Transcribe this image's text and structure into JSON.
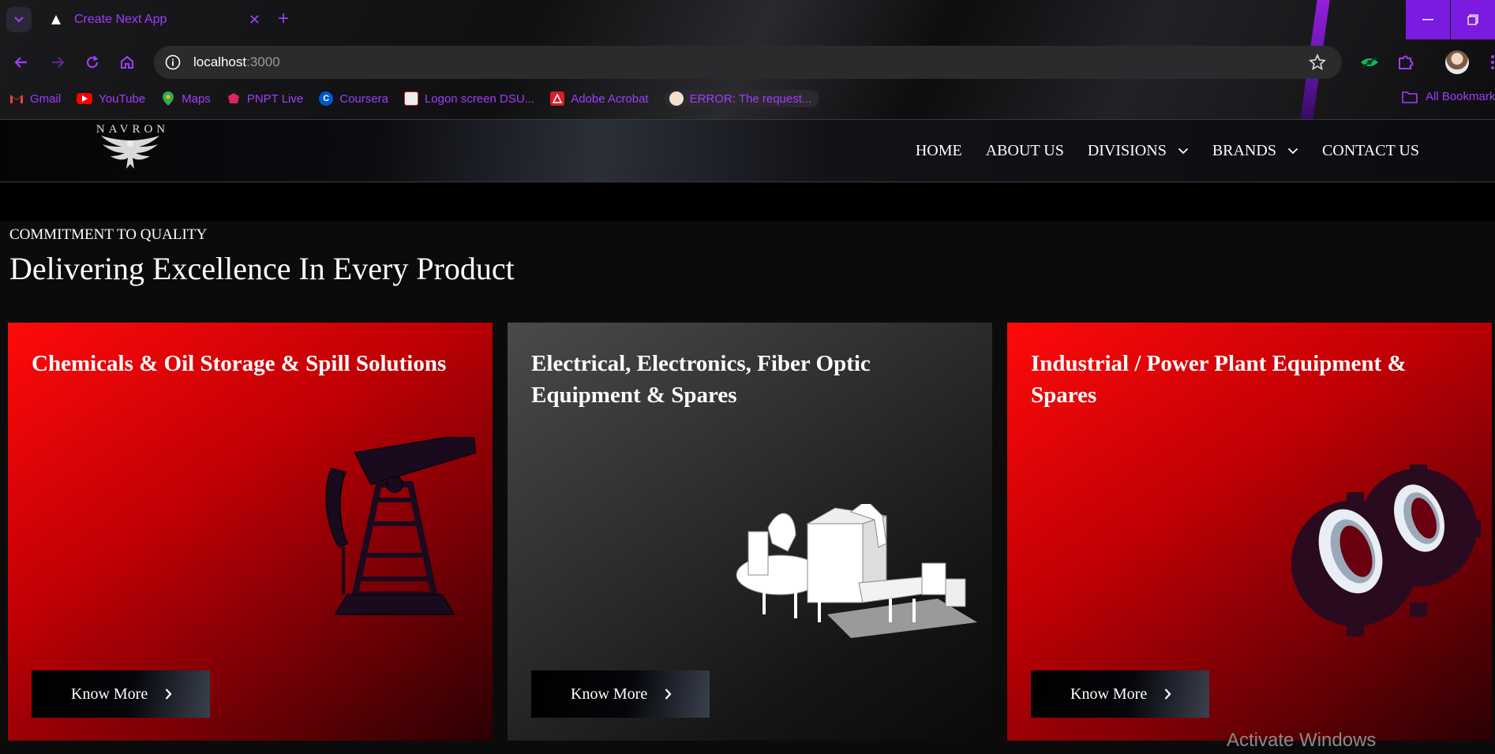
{
  "browser": {
    "tab_title": "Create Next App",
    "url_host": "localhost",
    "url_port": ":3000",
    "accent": "#a13cff",
    "bookmarks": [
      {
        "label": "Gmail",
        "icon": "gmail-icon"
      },
      {
        "label": "YouTube",
        "icon": "youtube-icon"
      },
      {
        "label": "Maps",
        "icon": "maps-icon"
      },
      {
        "label": "PNPT Live",
        "icon": "pnpt-icon"
      },
      {
        "label": "Coursera",
        "icon": "coursera-icon"
      },
      {
        "label": "Logon screen DSU...",
        "icon": "dsu-icon"
      },
      {
        "label": "Adobe Acrobat",
        "icon": "acrobat-icon"
      },
      {
        "label": "ERROR: The request...",
        "icon": "error-page-icon"
      }
    ],
    "all_bookmarks": "All Bookmark"
  },
  "site": {
    "logo_text": "NAVRON",
    "nav": [
      {
        "label": "HOME"
      },
      {
        "label": "ABOUT US"
      },
      {
        "label": "DIVISIONS"
      },
      {
        "label": "BRANDS"
      },
      {
        "label": "CONTACT US"
      }
    ]
  },
  "main": {
    "eyebrow": "COMMITMENT TO QUALITY",
    "headline": "Delivering Excellence In Every Product",
    "cards": [
      {
        "title": "Chemicals & Oil Storage & Spill Solutions",
        "button": "Know More",
        "image": "oil-pump-icon",
        "color": "#ff0a0a"
      },
      {
        "title": "Electrical, Electronics, Fiber Optic Equipment & Spares",
        "button": "Know More",
        "image": "industrial-machine-icon",
        "color": "#4a4a4a"
      },
      {
        "title": "Industrial / Power Plant Equipment & Spares",
        "button": "Know More",
        "image": "gear-rings-icon",
        "color": "#ff0a0a"
      }
    ]
  },
  "overlay": {
    "activate_windows": "Activate Windows"
  }
}
